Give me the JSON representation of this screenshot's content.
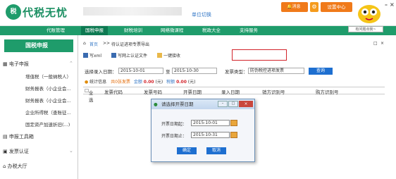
{
  "app": {
    "logo_mark": "税",
    "name": "代税无忧",
    "unit_switch": "单位切换",
    "messages": "消息",
    "settings": "设置中心",
    "help": "有问题点我~",
    "win_min": "–",
    "win_close": "×"
  },
  "nav": [
    "代账管理",
    "国税申报",
    "财税培训",
    "网络微课程",
    "税政大全",
    "支持服务"
  ],
  "sidebar": {
    "title": "国税申报",
    "groups": [
      {
        "label": "电子申报",
        "items": [
          "增值税（一般纳税人）",
          "财务报表（小企业会...",
          "财务报表（小企业会...",
          "企业所得税（查账征...",
          "固定资产加速折旧(...)"
        ]
      },
      {
        "label": "申报工具箱"
      },
      {
        "label": "发票认证"
      },
      {
        "label": "办税大厅"
      }
    ]
  },
  "breadcrumb": {
    "home": "首页",
    "sep": ">>",
    "current": "待认证进项专票导出",
    "close": "×",
    "pin": "□"
  },
  "toolbar": {
    "xml": "写xml",
    "upload": "写网上认证文件",
    "one_click": "一键接收"
  },
  "filter": {
    "date_label": "选择录入日期：",
    "date_from": "2015-10-01",
    "to": "至",
    "date_to": "2015-10-30",
    "type_label": "发票类型：",
    "type_value": "防伪税控进项发票",
    "query": "查询"
  },
  "stats": {
    "label": "统计信息",
    "count": "共0张发票",
    "amount_label": "金额",
    "amount": "0.00",
    "unit": "(元)",
    "tax_label": "税额",
    "tax": "0.00",
    "tax_unit": "(元)"
  },
  "table": {
    "headers": [
      "全选",
      "发票代码",
      "发票号码",
      "开票日期",
      "录入日期",
      "销方识别号",
      "购方识别号"
    ]
  },
  "dialog": {
    "title": "请选择开票日期",
    "start_label": "开票日期起：",
    "start": "2015-10-01",
    "end_label": "开票日期止：",
    "end": "2015-10-31",
    "ok": "确定",
    "cancel": "取消"
  }
}
